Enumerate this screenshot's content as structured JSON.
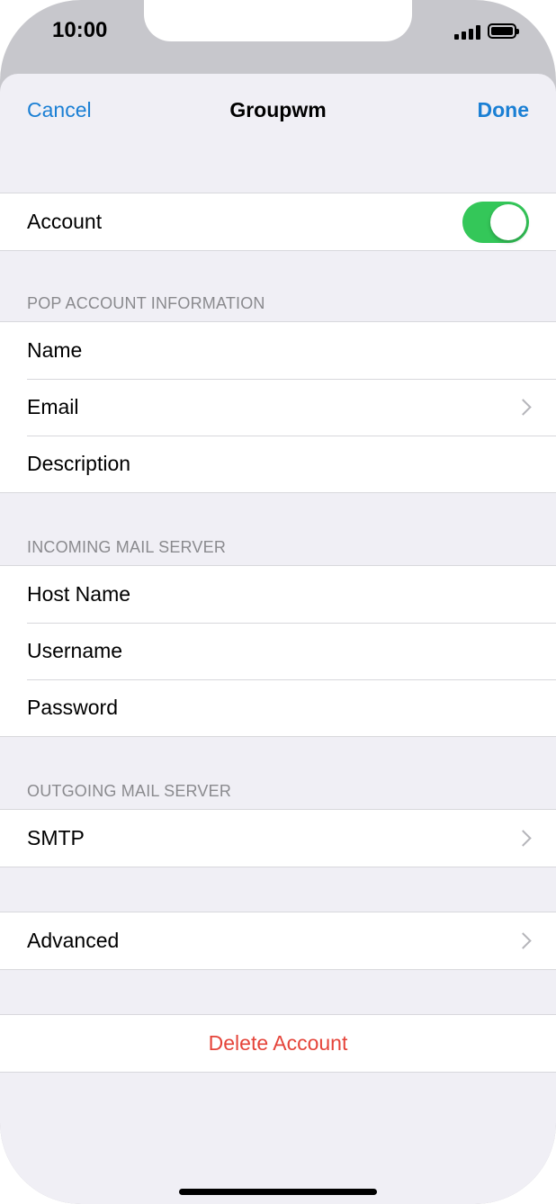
{
  "status_bar": {
    "time": "10:00"
  },
  "nav": {
    "cancel_label": "Cancel",
    "title": "Groupwm",
    "done_label": "Done"
  },
  "account": {
    "label": "Account",
    "enabled": true
  },
  "pop_section": {
    "header": "POP ACCOUNT INFORMATION",
    "name_label": "Name",
    "email_label": "Email",
    "description_label": "Description"
  },
  "incoming_section": {
    "header": "INCOMING MAIL SERVER",
    "host_label": "Host Name",
    "username_label": "Username",
    "password_label": "Password"
  },
  "outgoing_section": {
    "header": "OUTGOING MAIL SERVER",
    "smtp_label": "SMTP"
  },
  "advanced_label": "Advanced",
  "delete_label": "Delete Account",
  "colors": {
    "accent": "#1a7fd4",
    "toggle_on": "#34c759",
    "destructive": "#e5443a",
    "grouped_background": "#f0eff5"
  },
  "icons": [
    "signal-icon",
    "battery-icon",
    "chevron-right-icon"
  ]
}
